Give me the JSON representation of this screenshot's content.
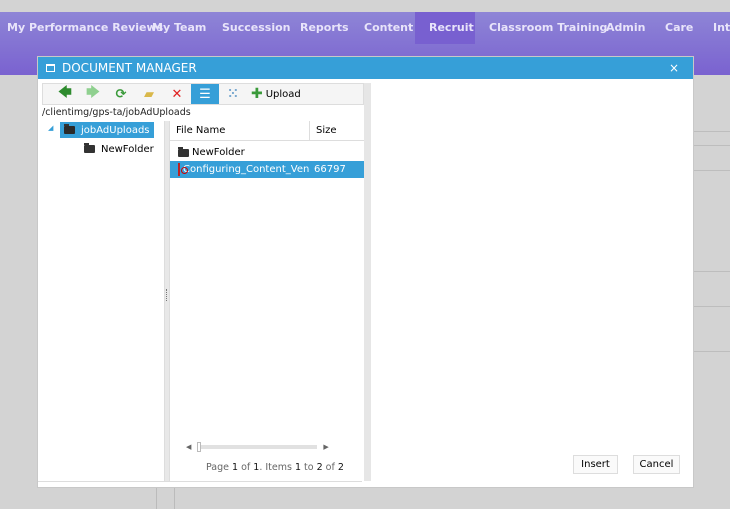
{
  "nav": {
    "items": [
      "My Performance Reviews",
      "My Team",
      "Succession",
      "Reports",
      "Content",
      "Recruit",
      "Classroom Training",
      "Admin",
      "Care",
      "Inte"
    ],
    "active": "Recruit"
  },
  "dialog": {
    "title": "DOCUMENT MANAGER",
    "close": "×",
    "toolbar": {
      "icons": [
        "back-arrow",
        "forward-arrow",
        "refresh",
        "new-folder",
        "delete",
        "list-view",
        "thumbnail-view",
        "upload"
      ],
      "upload_label": "Upload"
    },
    "path": "/clientimg/gps-ta/jobAdUploads",
    "tree": [
      {
        "label": "jobAdUploads",
        "selected": true
      },
      {
        "label": "NewFolder"
      }
    ],
    "grid": {
      "columns": [
        "File Name",
        "Size"
      ],
      "rows": [
        {
          "name": "NewFolder",
          "size": "",
          "type": "folder"
        },
        {
          "name": "Configuring_Content_Vendc",
          "size": "66797",
          "type": "pdf",
          "selected": true
        }
      ]
    },
    "pager": {
      "p1": "Page ",
      "page": "1",
      "p2": " of ",
      "pages": "1",
      "p3": ". Items ",
      "from": "1",
      "p4": " to ",
      "to": "2",
      "p5": " of ",
      "total": "2"
    },
    "insert": "Insert",
    "cancel": "Cancel"
  },
  "colors": {
    "accent": "#369fd8",
    "nav": "#7e6cd2"
  }
}
